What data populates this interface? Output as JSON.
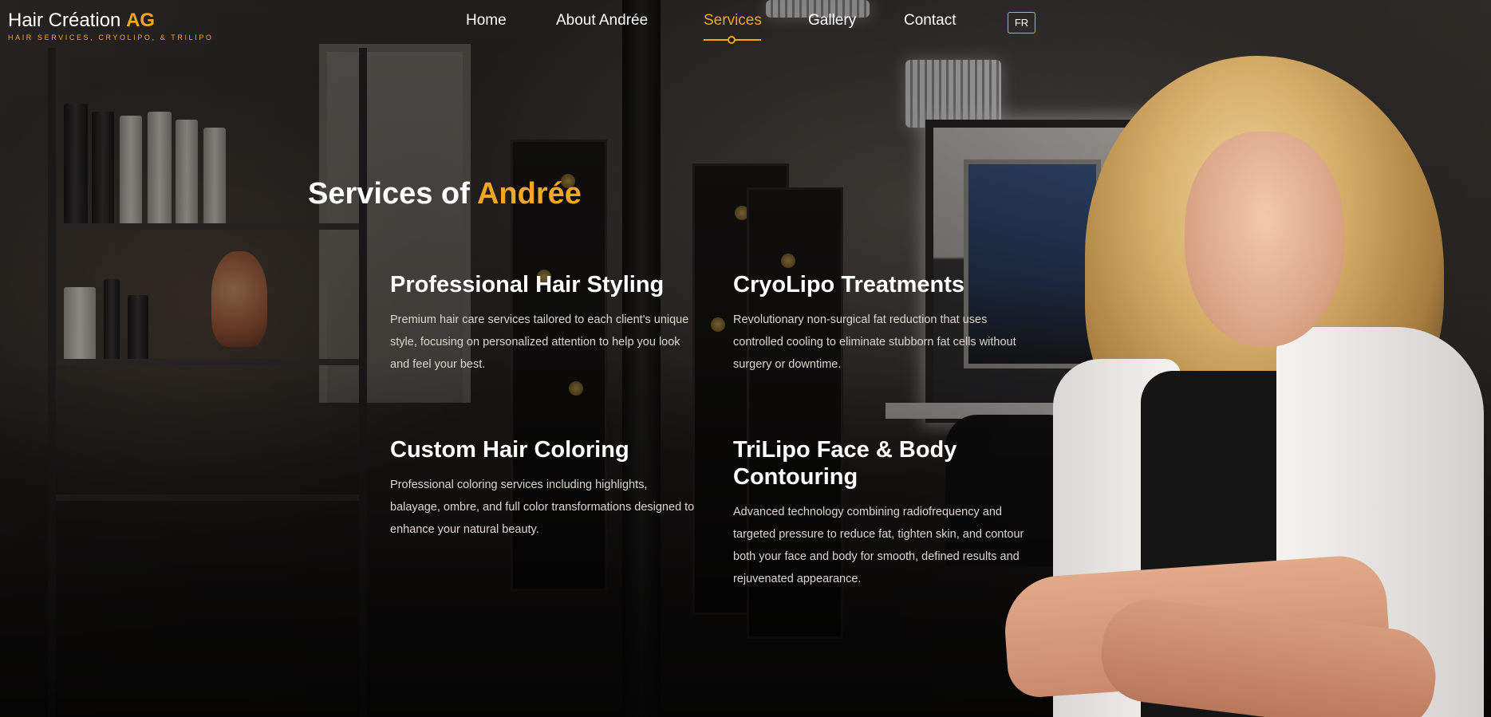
{
  "brand": {
    "name": "Hair Création",
    "accent": "AG",
    "tagline": "HAIR SERVICES, CRYOLIPO, & TRILIPO"
  },
  "nav": {
    "items": [
      {
        "label": "Home"
      },
      {
        "label": "About Andrée"
      },
      {
        "label": "Services",
        "active": true
      },
      {
        "label": "Gallery"
      },
      {
        "label": "Contact"
      }
    ],
    "language": "FR"
  },
  "section": {
    "title": "Services of",
    "title_accent": "Andrée"
  },
  "services": [
    {
      "title": "Professional Hair Styling",
      "description": "Premium hair care services tailored to each client's unique style, focusing on personalized attention to help you look and feel your best."
    },
    {
      "title": "CryoLipo Treatments",
      "description": "Revolutionary non-surgical fat reduction that uses controlled cooling to eliminate stubborn fat cells without surgery or downtime."
    },
    {
      "title": "Custom Hair Coloring",
      "description": "Professional coloring services including highlights, balayage, ombre, and full color transformations designed to enhance your natural beauty."
    },
    {
      "title": "TriLipo Face & Body Contouring",
      "description": "Advanced technology combining radiofrequency and targeted pressure to reduce fat, tighten skin, and contour both your face and body for smooth, defined results and rejuvenated appearance."
    }
  ],
  "colors": {
    "accent": "#f5a623",
    "text": "#ffffff",
    "body_text": "#ddd6cf"
  },
  "icons": {
    "nav_active_marker": "circle-dot-icon"
  }
}
